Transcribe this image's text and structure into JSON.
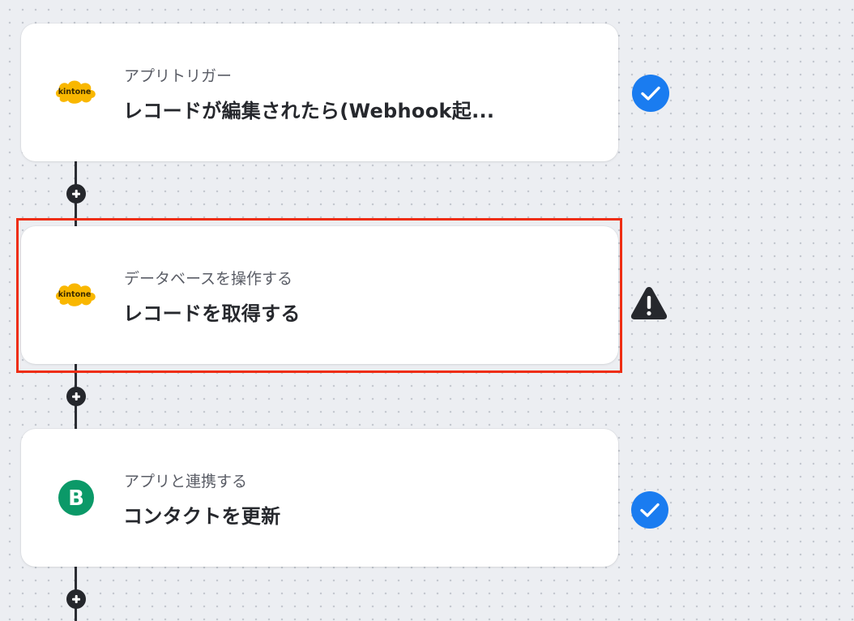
{
  "colors": {
    "canvas": "#eceef2",
    "card": "#ffffff",
    "success": "#1a7cf0",
    "warning": "#26282d",
    "highlight": "#ee2d12",
    "kintone": "#f9b700",
    "brevo": "#0b9968"
  },
  "steps": [
    {
      "subtitle": "アプリトリガー",
      "title": "レコードが編集されたら(Webhook起...",
      "app_icon": "kintone-logo",
      "logo_text": "kintone",
      "status": "success-check-icon"
    },
    {
      "subtitle": "データベースを操作する",
      "title": "レコードを取得する",
      "app_icon": "kintone-logo",
      "logo_text": "kintone",
      "status": "warning-triangle-icon",
      "selected": true
    },
    {
      "subtitle": "アプリと連携する",
      "title": "コンタクトを更新",
      "app_icon": "brevo-logo",
      "logo_text": "B",
      "status": "success-check-icon"
    }
  ],
  "add_step_icon": "plus-icon"
}
